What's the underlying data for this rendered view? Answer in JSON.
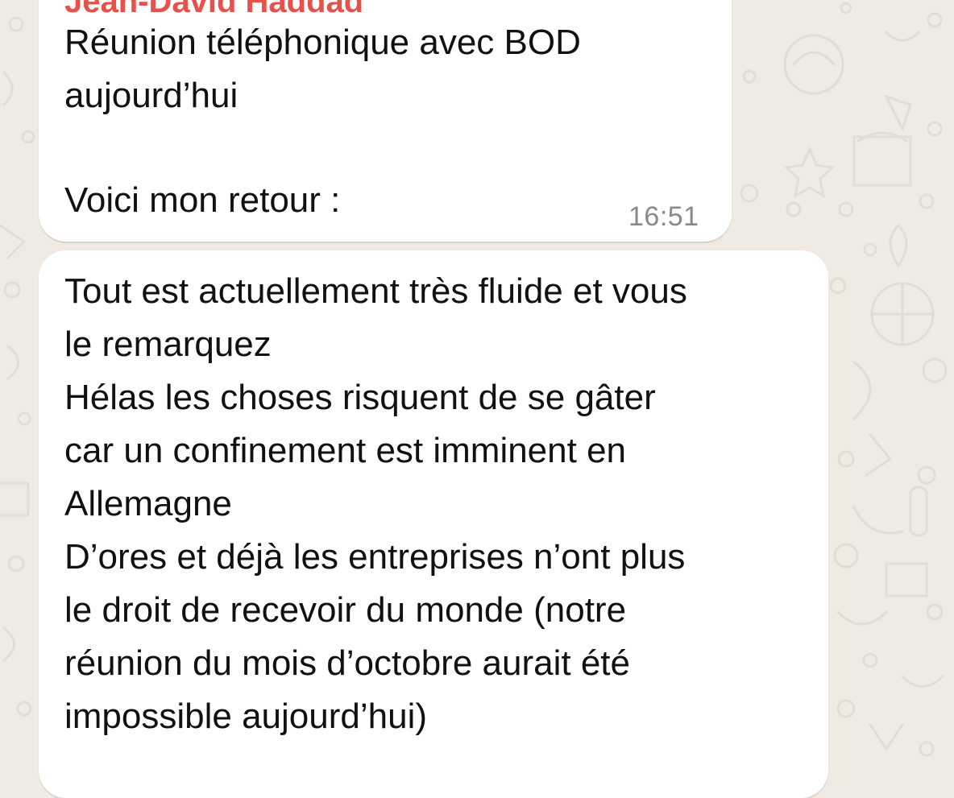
{
  "chat": {
    "background_color": "#efeae2",
    "bubble_color": "#ffffff",
    "sender_color": "#e8504a"
  },
  "message1": {
    "sender": "Jean-David Haddad",
    "lines": [
      "Réunion téléphonique avec BOD",
      "aujourd’hui",
      "Voici mon retour :"
    ],
    "time": "16:51"
  },
  "message2": {
    "lines": [
      "Tout est actuellement très fluide et vous",
      "le remarquez",
      "Hélas les choses risquent de se gâter",
      "car un confinement est imminent en",
      "Allemagne",
      "D’ores et déjà les entreprises n’ont plus",
      "le droit de recevoir du monde (notre",
      "réunion du mois d’octobre aurait été",
      "impossible aujourd’hui)"
    ]
  }
}
